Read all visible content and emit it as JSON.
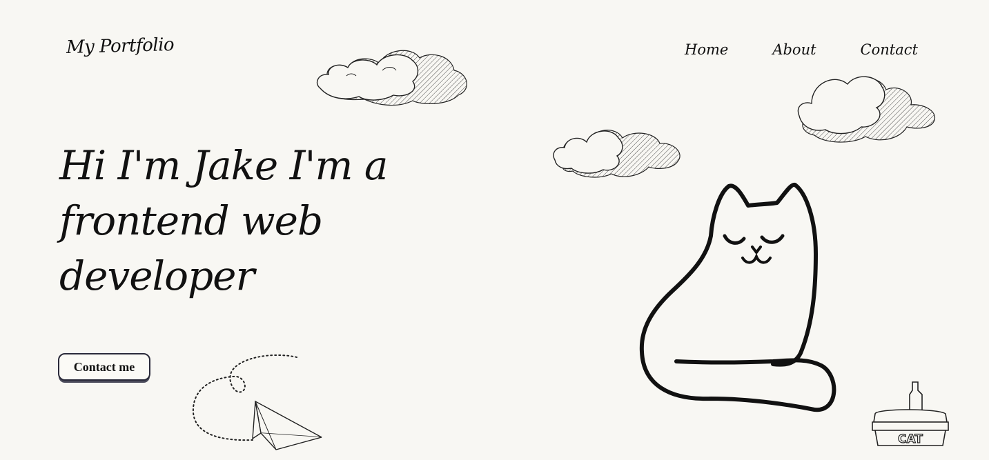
{
  "header": {
    "logo_text": "My Portfolio",
    "nav": [
      {
        "label": "Home"
      },
      {
        "label": "About"
      },
      {
        "label": "Contact"
      }
    ]
  },
  "hero": {
    "title": "Hi I'm Jake I'm a frontend web developer",
    "cta_label": "Contact me"
  },
  "illustrations": {
    "litter_box_text": "CAT"
  },
  "colors": {
    "background": "#f8f7f3",
    "ink": "#111111"
  }
}
